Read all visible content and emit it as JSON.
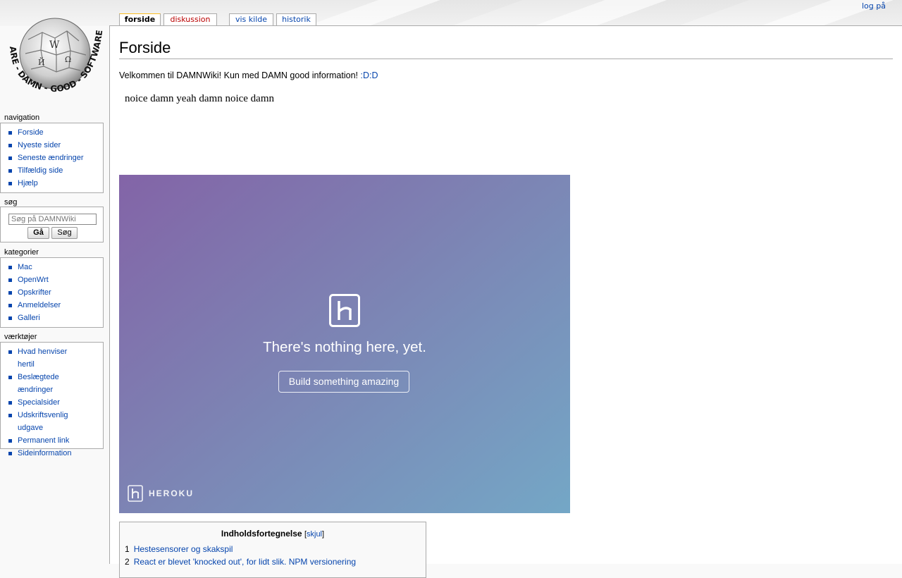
{
  "user": {
    "login": "log på"
  },
  "tabs": [
    {
      "label": "forside"
    },
    {
      "label": "diskussion"
    },
    {
      "label": "vis kilde"
    },
    {
      "label": "historik"
    }
  ],
  "page": {
    "title": "Forside",
    "intro_text": "Velkommen til DAMNWiki! Kun med DAMN good information! ",
    "intro_link": ":D:D",
    "noice_text": "noice damn yeah damn noice damn"
  },
  "heroku": {
    "message": "There's nothing here, yet.",
    "button": "Build something amazing",
    "brand": "HEROKU"
  },
  "toc": {
    "title": "Indholdsfortegnelse",
    "toggle": "skjul",
    "items": [
      {
        "num": "1",
        "label": "Hestesensorer og skakspil"
      },
      {
        "num": "2",
        "label": "React er blevet 'knocked out', for lidt slik. NPM versionering"
      }
    ]
  },
  "sidebar": {
    "navigation": {
      "heading": "navigation",
      "items": [
        "Forside",
        "Nyeste sider",
        "Seneste ændringer",
        "Tilfældig side",
        "Hjælp"
      ]
    },
    "search": {
      "heading": "søg",
      "placeholder": "Søg på DAMNWiki",
      "go": "Gå",
      "search": "Søg"
    },
    "categories": {
      "heading": "kategorier",
      "items": [
        "Mac",
        "OpenWrt",
        "Opskrifter",
        "Anmeldelser",
        "Galleri"
      ]
    },
    "tools": {
      "heading": "værktøjer",
      "items": [
        "Hvad henviser hertil",
        "Beslægtede ændringer",
        "Specialsider",
        "Udskriftsvenlig udgave",
        "Permanent link",
        "Sideinformation"
      ]
    }
  }
}
